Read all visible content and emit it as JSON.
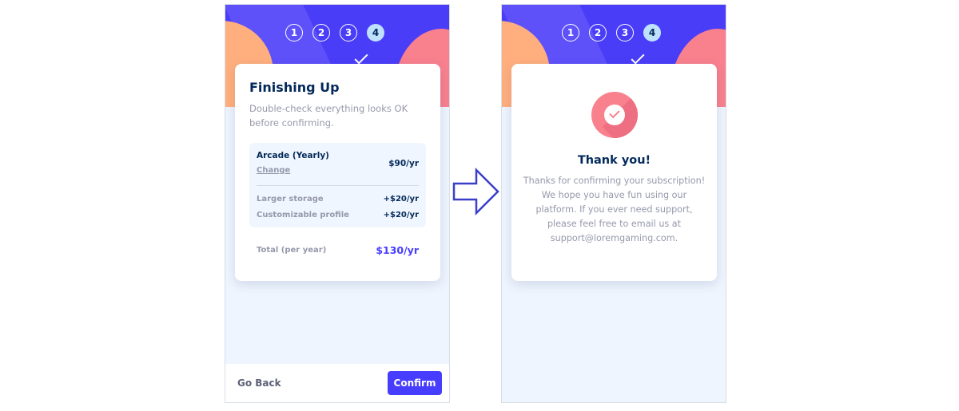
{
  "steps": [
    "1",
    "2",
    "3",
    "4"
  ],
  "summary": {
    "title": "Finishing Up",
    "description": "Double-check everything looks OK before confirming.",
    "plan_name": "Arcade (Yearly)",
    "change_label": "Change",
    "plan_price": "$90/yr",
    "addons": [
      {
        "name": "Larger storage",
        "price": "+$20/yr"
      },
      {
        "name": "Customizable profile",
        "price": "+$20/yr"
      }
    ],
    "total_label": "Total (per year)",
    "total_price": "$130/yr"
  },
  "footer": {
    "back_label": "Go Back",
    "confirm_label": "Confirm"
  },
  "thanks": {
    "title": "Thank you!",
    "message": "Thanks for confirming your subscription! We hope you have fun using our platform. If you ever need support, please feel free to email us at support@loremgaming.com."
  },
  "colors": {
    "accent": "#473dff",
    "banner": "#4a3df7",
    "active_step": "#bee2fd",
    "marine": "#02295a",
    "gray": "#9699ab",
    "success": "#f9818e"
  },
  "icons": {
    "success": "checkmark-circle-icon",
    "transition": "right-arrow-icon"
  }
}
